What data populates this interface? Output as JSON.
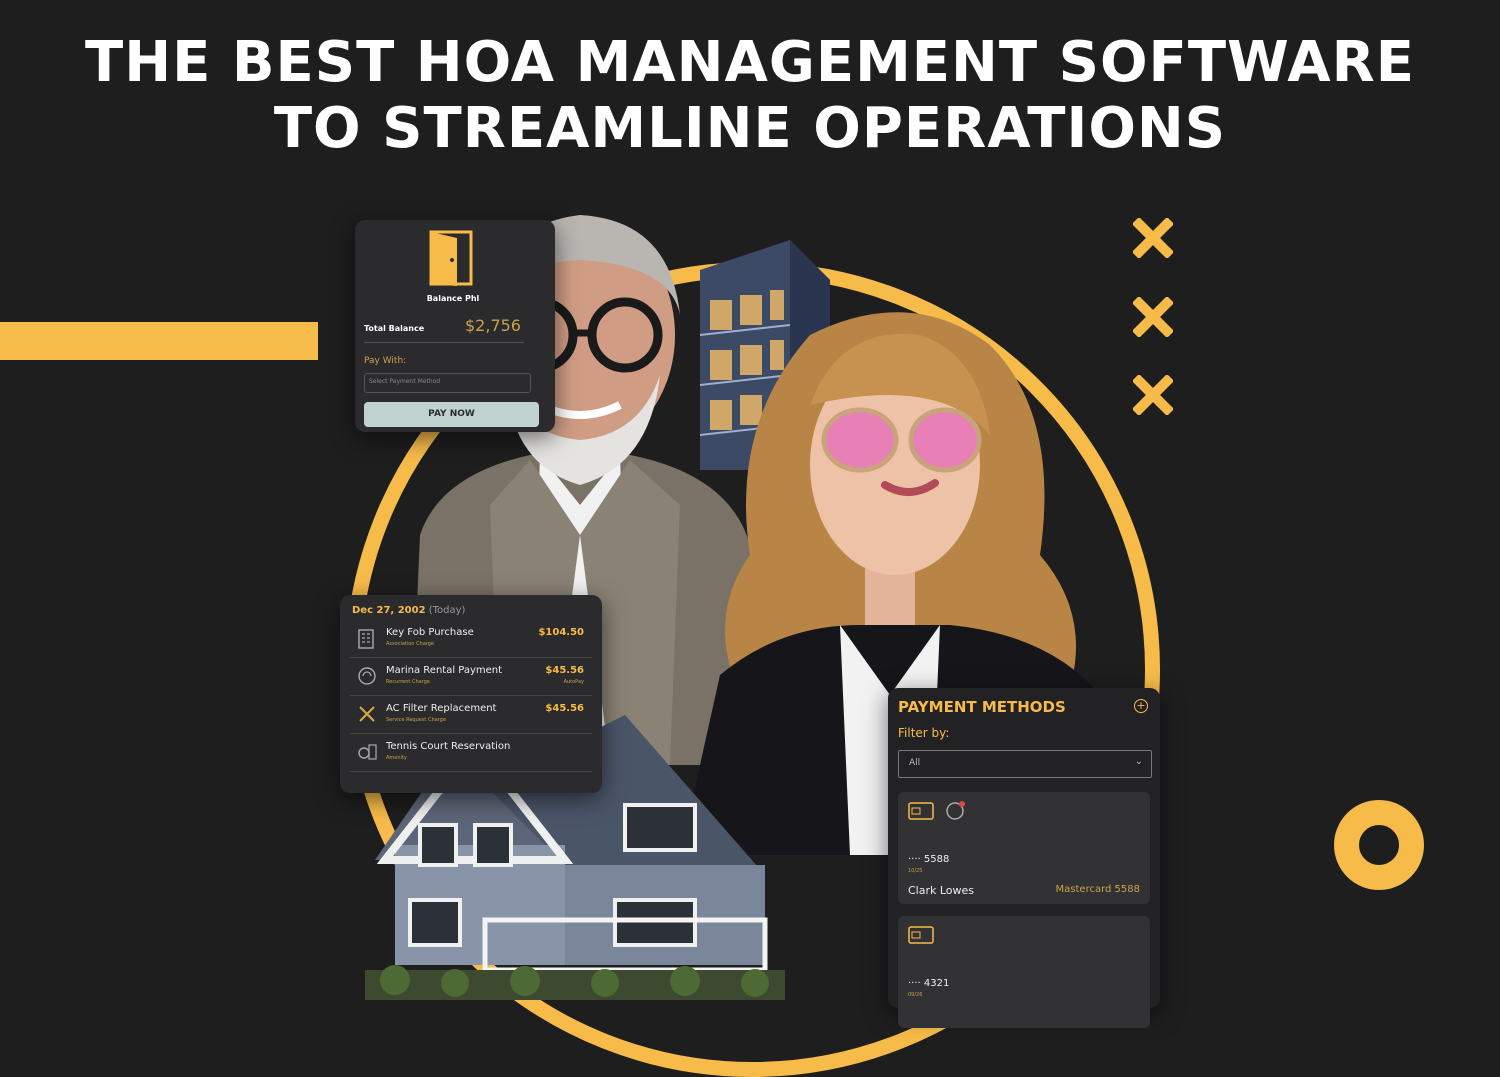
{
  "headline": {
    "line1": "THE BEST HOA MANAGEMENT SOFTWARE",
    "line2": "TO STREAMLINE OPERATIONS"
  },
  "colors": {
    "background": "#1e1e1f",
    "accent": "#f7bb4a",
    "card": "#2b2b2d",
    "button": "#bfd2cf"
  },
  "balance_card": {
    "icon": "door-icon",
    "account_name": "Balance Phl",
    "total_balance_label": "Total Balance",
    "total_balance_value": "$2,756",
    "pay_with_label": "Pay With:",
    "payment_method_placeholder": "Select Payment Method",
    "pay_now_label": "PAY NOW"
  },
  "transactions": {
    "date": "Dec 27, 2002",
    "date_suffix": "(Today)",
    "items": [
      {
        "icon": "building-icon",
        "title": "Key Fob Purchase",
        "subtitle": "Association Charge",
        "amount": "$104.50",
        "note": ""
      },
      {
        "icon": "recurring-icon",
        "title": "Marina Rental Payment",
        "subtitle": "Recurrent Charge",
        "amount": "$45.56",
        "note": "AutoPay"
      },
      {
        "icon": "tools-icon",
        "title": "AC Filter Replacement",
        "subtitle": "Service Request Charge",
        "amount": "$45.56",
        "note": ""
      },
      {
        "icon": "tennis-icon",
        "title": "Tennis Court Reservation",
        "subtitle": "Amenity",
        "amount": "",
        "note": ""
      }
    ]
  },
  "payment_methods": {
    "title": "PAYMENT METHODS",
    "filter_label": "Filter by:",
    "filter_value": "All",
    "cards": [
      {
        "icon": "credit-card-icon",
        "masked": "···· 5588",
        "expiry": "10/25",
        "holder": "Clark Lowes",
        "brand": "Mastercard 5588"
      },
      {
        "icon": "credit-card-icon",
        "masked": "···· 4321",
        "expiry": "09/26",
        "holder": "",
        "brand": ""
      }
    ]
  }
}
